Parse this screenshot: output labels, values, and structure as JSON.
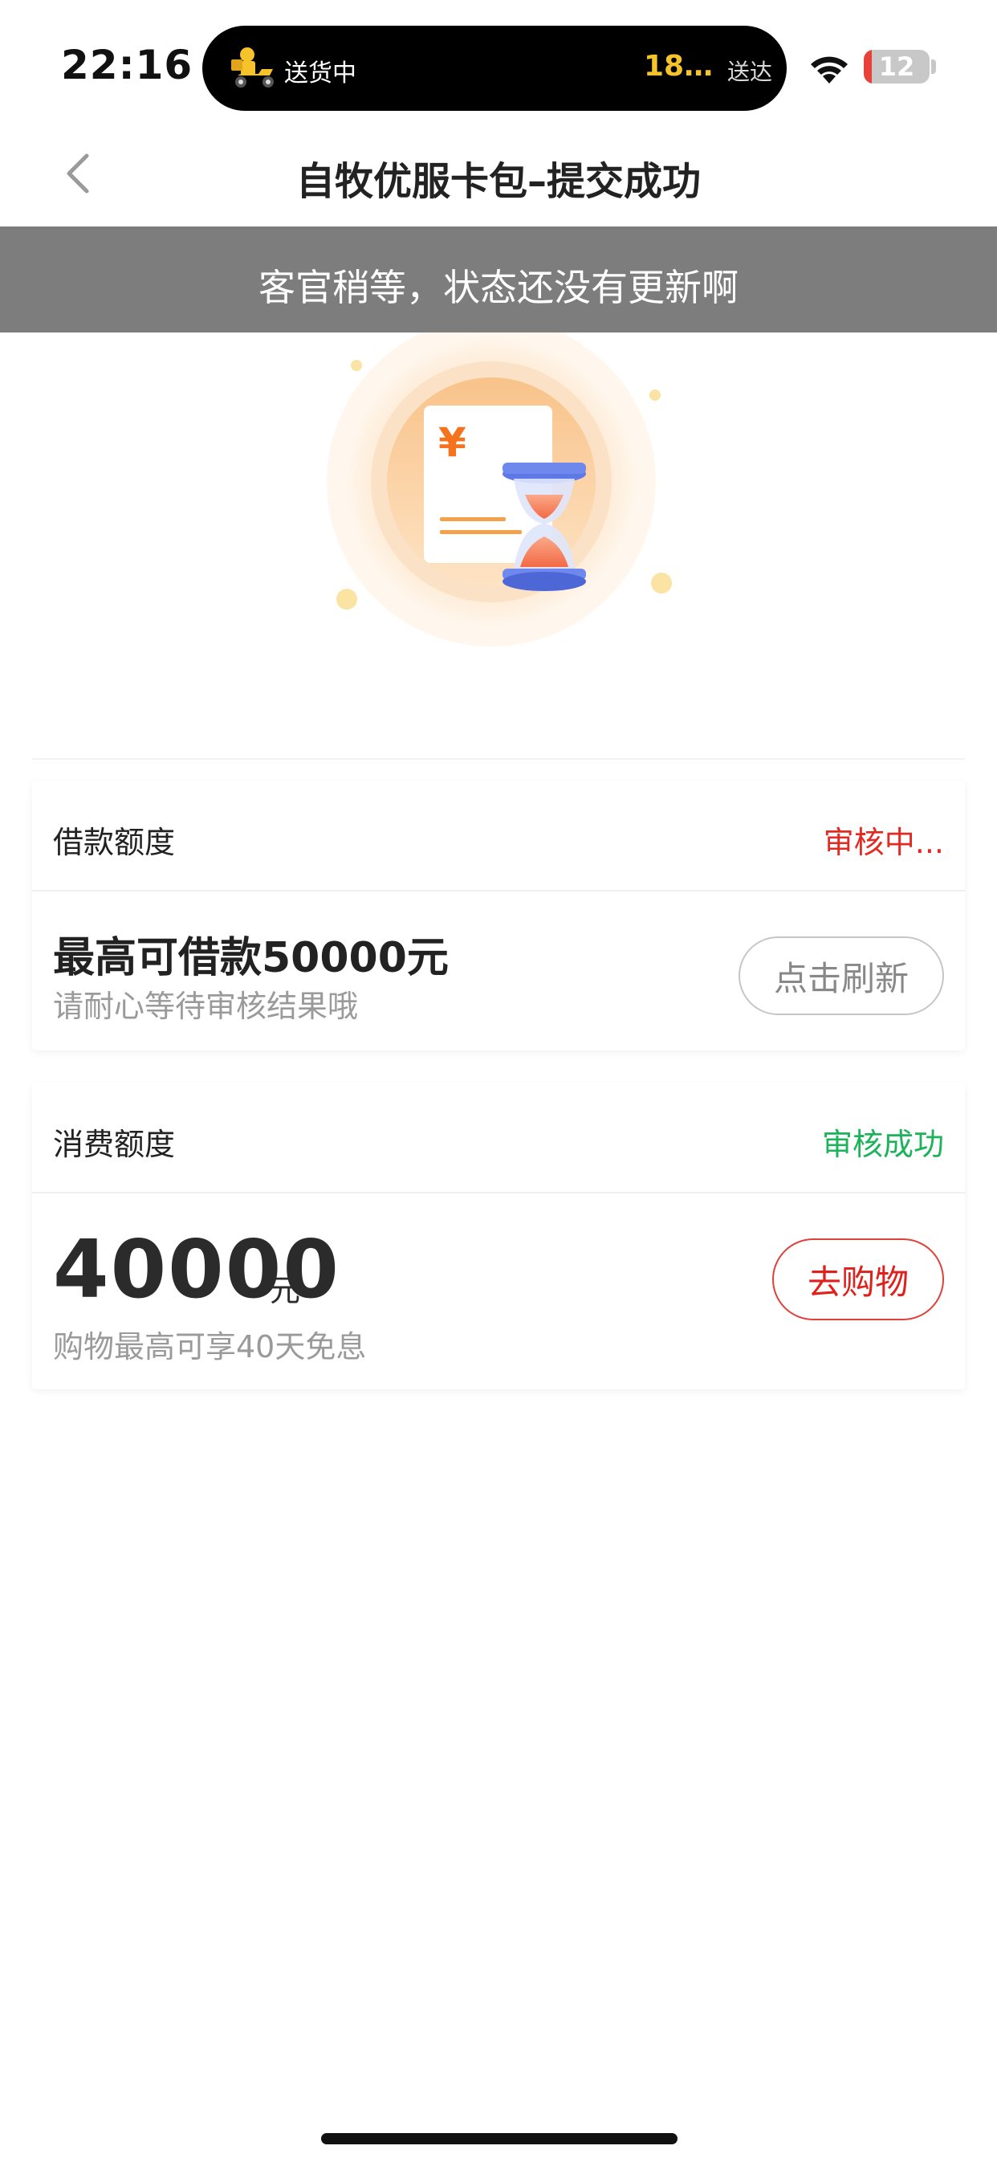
{
  "status_bar": {
    "time": "22:16",
    "live_activity": {
      "title": "送货中",
      "count": "18…",
      "right_label": "送达"
    },
    "battery_level": "12",
    "battery_fraction": 0.12
  },
  "nav": {
    "title": "自牧优服卡包–提交成功"
  },
  "toast": {
    "text": "客官稍等，状态还没有更新啊"
  },
  "illustration": {
    "icon": "hourglass-document-icon",
    "currency_symbol": "¥"
  },
  "loan_card": {
    "label": "借款额度",
    "status": "审核中...",
    "headline": "最高可借款50000元",
    "subtext": "请耐心等待审核结果哦",
    "button_label": "点击刷新"
  },
  "spend_card": {
    "label": "消费额度",
    "status": "审核成功",
    "amount": "40000",
    "unit": "元",
    "subtext": "购物最高可享40天免息",
    "button_label": "去购物"
  },
  "colors": {
    "pending": "#e02a22",
    "success": "#1cb35a",
    "accent_orange": "#f5a04a",
    "toast_bg": "#7d7d7d"
  }
}
